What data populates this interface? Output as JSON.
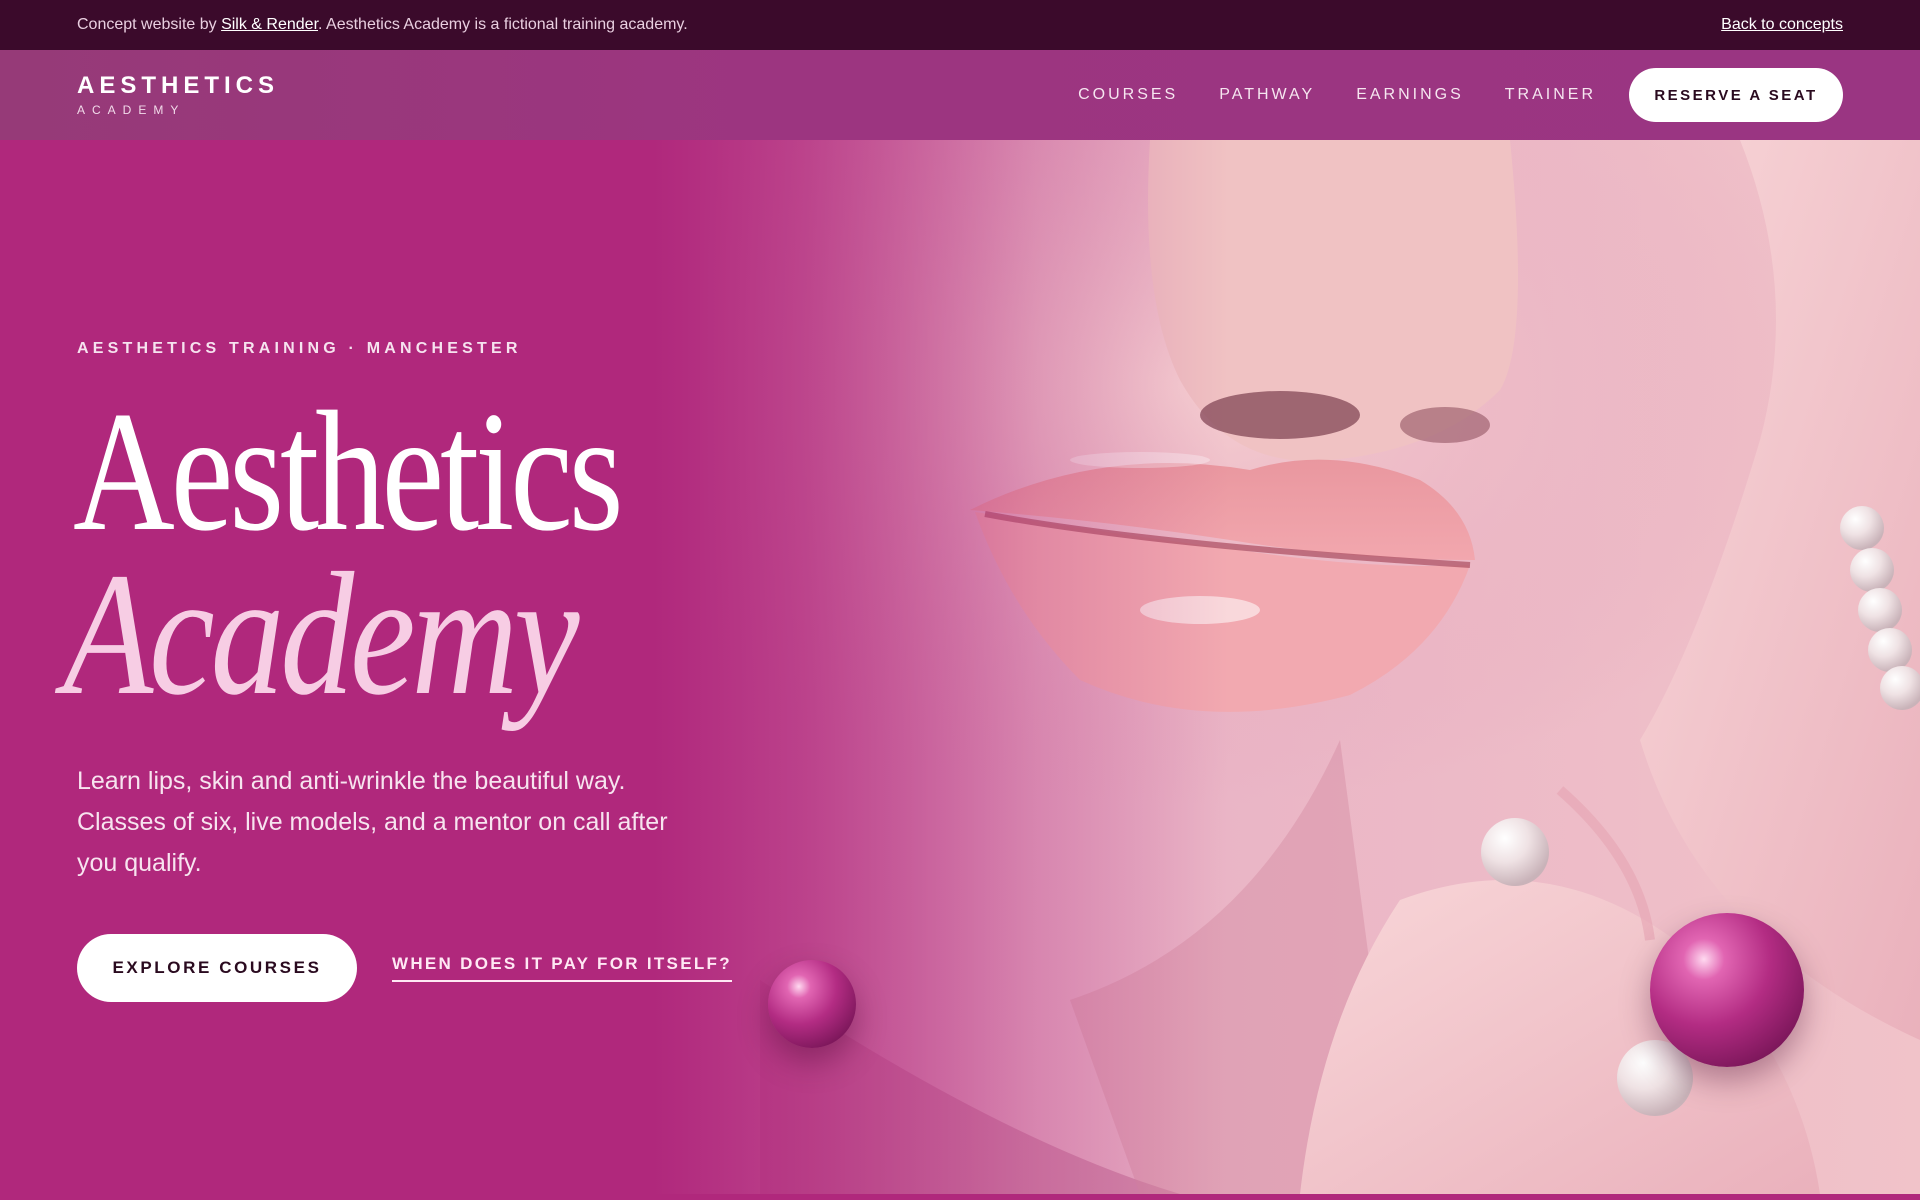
{
  "concept_bar": {
    "text_prefix": "Concept website by ",
    "link_label": "Silk & Render",
    "text_suffix": ". Aesthetics Academy is a fictional training academy.",
    "back_label": "Back to concepts"
  },
  "header": {
    "logo_main": "AESTHETICS",
    "logo_sub": "ACADEMY",
    "nav": [
      {
        "label": "COURSES"
      },
      {
        "label": "PATHWAY"
      },
      {
        "label": "EARNINGS"
      },
      {
        "label": "TRAINER"
      }
    ],
    "cta_label": "RESERVE A SEAT"
  },
  "hero": {
    "eyebrow": "AESTHETICS TRAINING · MANCHESTER",
    "headline_line1": "Aesthetics",
    "headline_line2": "Academy",
    "lead": "Learn lips, skin and anti-wrinkle the beautiful way. Classes of six, live models, and a mentor on call after you qualify.",
    "primary_cta": "EXPLORE COURSES",
    "secondary_cta": "WHEN DOES IT PAY FOR ITSELF?"
  },
  "colors": {
    "concept_bar_bg": "#3b0a2b",
    "header_bg": "#9a3582",
    "hero_bg": "#b0287c",
    "headline_accent": "#f7cde4"
  }
}
